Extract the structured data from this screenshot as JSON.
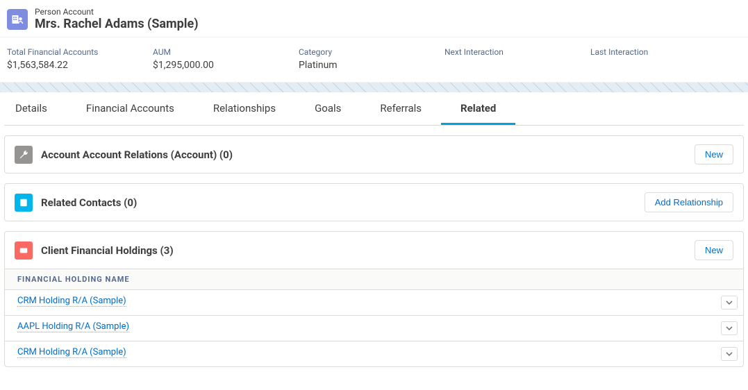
{
  "header": {
    "type_label": "Person Account",
    "title": "Mrs. Rachel Adams (Sample)"
  },
  "kpis": [
    {
      "label": "Total Financial Accounts",
      "value": "$1,563,584.22"
    },
    {
      "label": "AUM",
      "value": "$1,295,000.00"
    },
    {
      "label": "Category",
      "value": "Platinum"
    },
    {
      "label": "Next Interaction",
      "value": ""
    },
    {
      "label": "Last Interaction",
      "value": ""
    }
  ],
  "tabs": {
    "items": [
      "Details",
      "Financial Accounts",
      "Relationships",
      "Goals",
      "Referrals",
      "Related"
    ],
    "active_index": 5
  },
  "cards": {
    "relations": {
      "title": "Account Account Relations (Account) (0)",
      "action_label": "New"
    },
    "contacts": {
      "title": "Related Contacts (0)",
      "action_label": "Add Relationship"
    },
    "holdings": {
      "title": "Client Financial Holdings (3)",
      "action_label": "New",
      "column_header": "Financial Holding Name",
      "rows": [
        "CRM Holding R/A (Sample)",
        "AAPL Holding R/A (Sample)",
        "CRM Holding R/A (Sample)"
      ]
    }
  }
}
